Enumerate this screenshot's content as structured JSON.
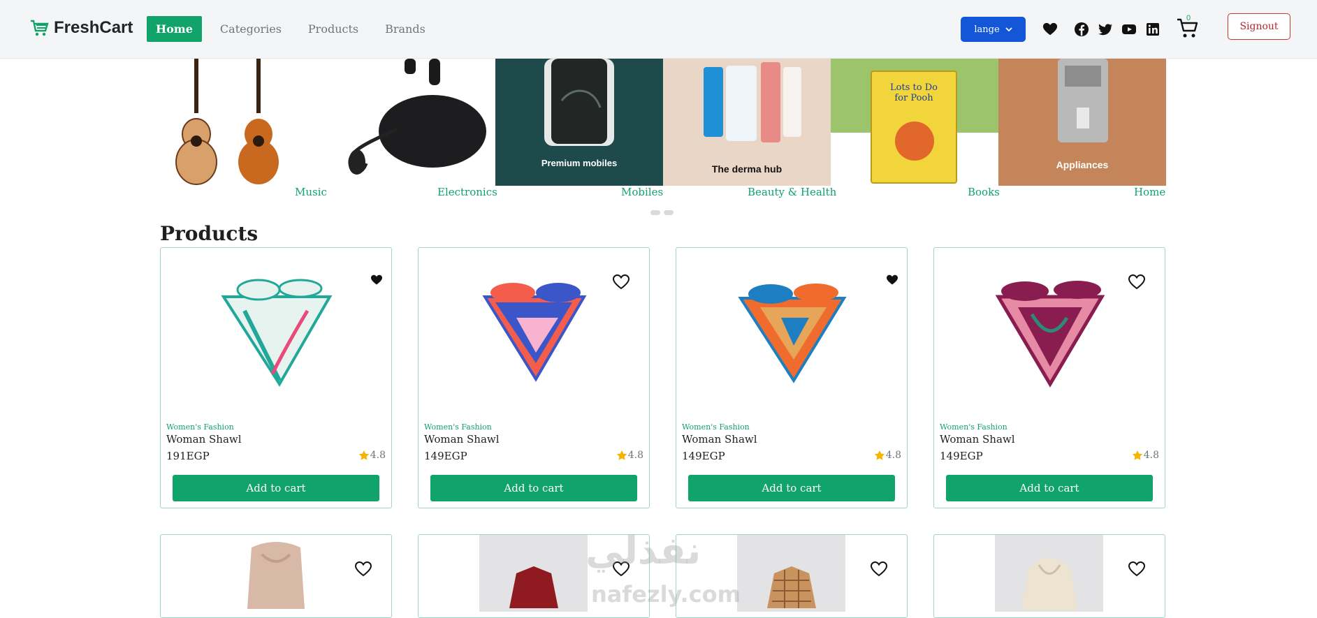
{
  "brand": {
    "name": "FreshCart"
  },
  "nav": {
    "links": [
      {
        "label": "Home",
        "active": true
      },
      {
        "label": "Categories",
        "active": false
      },
      {
        "label": "Products",
        "active": false
      },
      {
        "label": "Brands",
        "active": false
      }
    ],
    "language_label": "lange",
    "cart_count": "0",
    "signout_label": "Signout",
    "icons": [
      "heart-icon",
      "facebook-icon",
      "twitter-icon",
      "youtube-icon",
      "linkedin-icon",
      "cart-icon"
    ]
  },
  "slider": {
    "slides": [
      {
        "caption": "",
        "image": "guitars"
      },
      {
        "caption": "",
        "image": "earbuds"
      },
      {
        "caption": "Premium mobiles",
        "image": "phone"
      },
      {
        "caption": "The derma hub",
        "image": "skincare"
      },
      {
        "caption": "",
        "image": "book"
      },
      {
        "caption": "Appliances",
        "image": "coffee-machine"
      }
    ],
    "category_labels": [
      "Music",
      "Electronics",
      "Mobiles",
      "Beauty & Health",
      "Books",
      "Home"
    ],
    "dots": 2
  },
  "products_title": "Products",
  "products": [
    {
      "category": "Women's Fashion",
      "name": "Woman Shawl",
      "price": "191EGP",
      "rating": "4.8",
      "favorited": true,
      "add_label": "Add to cart",
      "colors": [
        "#e7f3ee",
        "#22a89a",
        "#e94a7a"
      ]
    },
    {
      "category": "Women's Fashion",
      "name": "Woman Shawl",
      "price": "149EGP",
      "rating": "4.8",
      "favorited": false,
      "add_label": "Add to cart",
      "colors": [
        "#3a56c8",
        "#f45d4c",
        "#f7b3d0"
      ]
    },
    {
      "category": "Women's Fashion",
      "name": "Woman Shawl",
      "price": "149EGP",
      "rating": "4.8",
      "favorited": true,
      "add_label": "Add to cart",
      "colors": [
        "#1d7fc1",
        "#f06b2e",
        "#e7a55a"
      ]
    },
    {
      "category": "Women's Fashion",
      "name": "Woman Shawl",
      "price": "149EGP",
      "rating": "4.8",
      "favorited": false,
      "add_label": "Add to cart",
      "colors": [
        "#8a1d4f",
        "#e78aa6",
        "#2b8a78"
      ]
    }
  ],
  "watermark": {
    "arabic": "نفذلي",
    "latin": "nafezly.com"
  },
  "colors": {
    "brand_green": "#10a36a",
    "lang_blue": "#1456d8",
    "signout_red": "#b02a37"
  }
}
